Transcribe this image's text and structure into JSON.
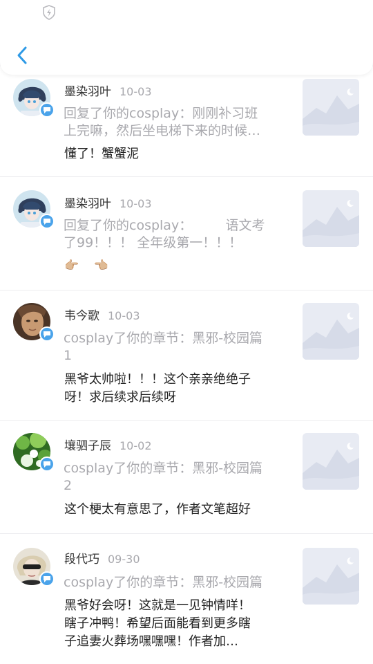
{
  "header": {
    "back_icon": "chevron-left-icon",
    "status_icon": "shield-bolt-icon",
    "accent_color": "#2e9ae6"
  },
  "items": [
    {
      "name": "墨染羽叶",
      "date": "10-03",
      "quote_line1": "回复了你的cosplay：刚刚补习班",
      "quote_line2": "上完嘛，然后坐电梯下来的时候…",
      "comment_line1": "懂了！蟹蟹泥",
      "comment_line2": "",
      "comment_line3": ""
    },
    {
      "name": "墨染羽叶",
      "date": "10-03",
      "quote_line1": "回复了你的cosplay：        语文考",
      "quote_line2": "了99！！！ 全年级第一！！！",
      "comment_line1": "👉🏼    👈🏼",
      "comment_line2": "",
      "comment_line3": ""
    },
    {
      "name": "韦今歌",
      "date": "10-03",
      "quote_line1": "cosplay了你的章节：黑邪-校园篇",
      "quote_line2": "1",
      "comment_line1": "黑爷太帅啦！！！这个亲亲绝绝子",
      "comment_line2": "呀！求后续求后续呀",
      "comment_line3": ""
    },
    {
      "name": "壤驷子辰",
      "date": "10-02",
      "quote_line1": "cosplay了你的章节：黑邪-校园篇",
      "quote_line2": "2",
      "comment_line1": "这个梗太有意思了，作者文笔超好",
      "comment_line2": "",
      "comment_line3": ""
    },
    {
      "name": "段代巧",
      "date": "09-30",
      "quote_line1": "cosplay了你的章节：黑邪-校园篇",
      "quote_line2": "",
      "comment_line1": "黑爷好会呀！这就是一见钟情咩！",
      "comment_line2": "瞎子冲鸭！希望后面能看到更多瞎",
      "comment_line3": "子追妻火葬场嘿嘿嘿！作者加…"
    }
  ]
}
